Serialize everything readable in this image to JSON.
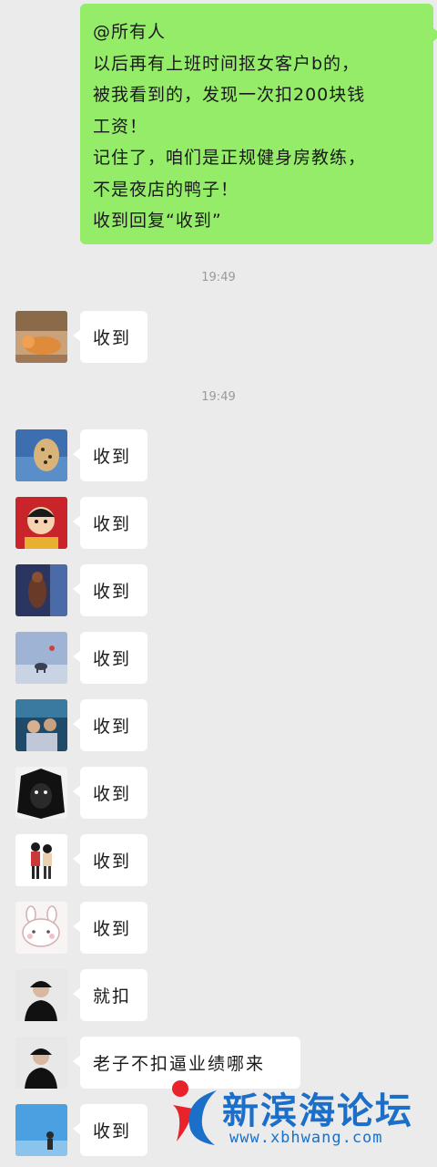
{
  "sent_message": {
    "lines": [
      "@所有人",
      "以后再有上班时间抠女客户b的，",
      "被我看到的，发现一次扣200块钱",
      "工资！",
      "记住了，咱们是正规健身房教练，",
      "不是夜店的鸭子！",
      "收到回复“收到”"
    ]
  },
  "timestamps": [
    "19:49",
    "19:49"
  ],
  "replies": [
    {
      "text": "收到",
      "avatar": "cat-avatar"
    },
    {
      "text": "收到",
      "avatar": "cheetah-avatar"
    },
    {
      "text": "收到",
      "avatar": "cartoon-boy-avatar"
    },
    {
      "text": "收到",
      "avatar": "dark-photo-avatar"
    },
    {
      "text": "收到",
      "avatar": "elephant-sky-avatar"
    },
    {
      "text": "收到",
      "avatar": "group-photo-avatar"
    },
    {
      "text": "收到",
      "avatar": "manga-face-avatar"
    },
    {
      "text": "收到",
      "avatar": "couple-avatar"
    },
    {
      "text": "收到",
      "avatar": "rabbit-avatar"
    },
    {
      "text": "就扣",
      "avatar": "man-cap-avatar"
    },
    {
      "text": "老子不扣逼业绩哪来",
      "avatar": "man-cap-avatar"
    },
    {
      "text": "收到",
      "avatar": "blue-sky-avatar"
    }
  ],
  "watermark": {
    "title": "新滨海论坛",
    "url": "www.xbhwang.com"
  },
  "colors": {
    "background": "#ebebeb",
    "sent_bubble": "#95ec69",
    "received_bubble": "#ffffff",
    "watermark": "#1c6fc9"
  }
}
